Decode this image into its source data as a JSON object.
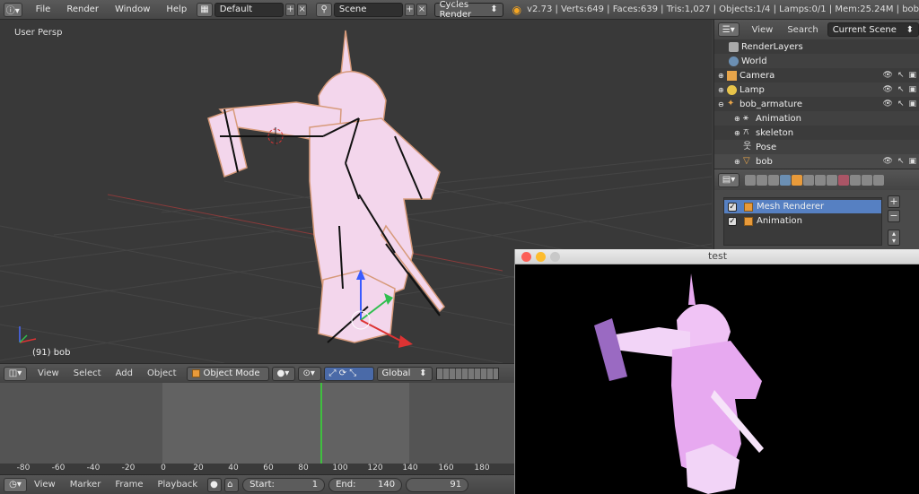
{
  "topbar": {
    "info_icon": "info-icon",
    "menus": [
      "File",
      "Render",
      "Window",
      "Help"
    ],
    "layout_value": "Default",
    "scene_value": "Scene",
    "engine_value": "Cycles Render",
    "stats": "v2.73 | Verts:649 | Faces:639 | Tris:1,027 | Objects:1/4 | Lamps:0/1 | Mem:25.24M | bob"
  },
  "viewport": {
    "view_label": "User Persp",
    "object_label": "(91) bob"
  },
  "viewport_header": {
    "menus": [
      "View",
      "Select",
      "Add",
      "Object"
    ],
    "mode_value": "Object Mode",
    "orientation_value": "Global"
  },
  "timeline": {
    "ticks": [
      "-80",
      "-60",
      "-40",
      "-20",
      "0",
      "20",
      "40",
      "60",
      "80",
      "100",
      "120",
      "140",
      "160",
      "180"
    ],
    "current_frame_marker": 91,
    "menus": [
      "View",
      "Marker",
      "Frame",
      "Playback"
    ],
    "start_label": "Start:",
    "start_value": "1",
    "end_label": "End:",
    "end_value": "140",
    "current_value": "91"
  },
  "outliner": {
    "menus": [
      "View",
      "Search"
    ],
    "filter_value": "Current Scene",
    "items": [
      {
        "label": "RenderLayers",
        "icon": "renderlayers-icon"
      },
      {
        "label": "World",
        "icon": "world-icon"
      },
      {
        "label": "Camera",
        "icon": "camera-icon"
      },
      {
        "label": "Lamp",
        "icon": "lamp-icon"
      },
      {
        "label": "bob_armature",
        "icon": "armature-icon"
      },
      {
        "label": "Animation",
        "icon": "animation-icon"
      },
      {
        "label": "skeleton",
        "icon": "skeleton-icon"
      },
      {
        "label": "Pose",
        "icon": "pose-icon"
      },
      {
        "label": "bob",
        "icon": "mesh-icon"
      }
    ]
  },
  "properties": {
    "components": [
      {
        "label": "Mesh Renderer",
        "checked": true,
        "selected": true
      },
      {
        "label": "Animation",
        "checked": true,
        "selected": false
      }
    ],
    "add_label": "+",
    "remove_label": "−"
  },
  "test_window": {
    "title": "test"
  },
  "colors": {
    "accent_selection": "#5680c2",
    "mesh_pink": "#f3d6ec",
    "render_pink": "#e7a9f0",
    "frame_marker": "#3fbf3f"
  }
}
